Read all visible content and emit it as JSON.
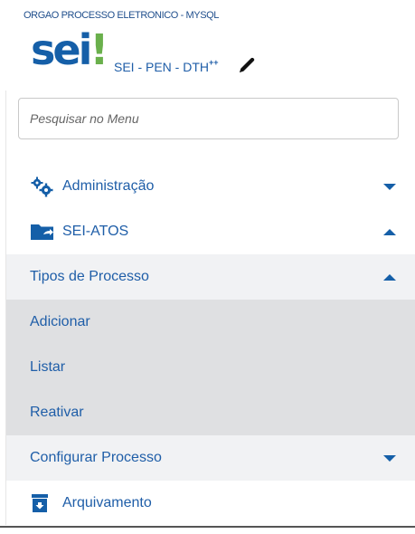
{
  "header": {
    "org_name": "ORGAO PROCESSO ELETRONICO - MYSQL",
    "logo_text": "sei",
    "logo_bang": "!",
    "unit_label": "SEI - PEN - DTH",
    "unit_sup": "++"
  },
  "search": {
    "placeholder": "Pesquisar no Menu"
  },
  "menu": {
    "items": [
      {
        "label": "Administração",
        "icon": "gears-icon",
        "state": "collapsed"
      },
      {
        "label": "SEI-ATOS",
        "icon": "folder-share-icon",
        "state": "expanded"
      },
      {
        "label": "Tipos de Processo",
        "state": "expanded"
      },
      {
        "label": "Adicionar"
      },
      {
        "label": "Listar"
      },
      {
        "label": "Reativar"
      },
      {
        "label": "Configurar Processo",
        "state": "collapsed"
      },
      {
        "label": "Arquivamento",
        "icon": "archive-icon"
      }
    ]
  },
  "colors": {
    "brand_blue": "#155fa8",
    "logo_green": "#6ab04c",
    "link_text": "#1f5ea8",
    "submenu_bg": "#f1f2f4",
    "subsubmenu_bg": "#dfe0e2"
  }
}
